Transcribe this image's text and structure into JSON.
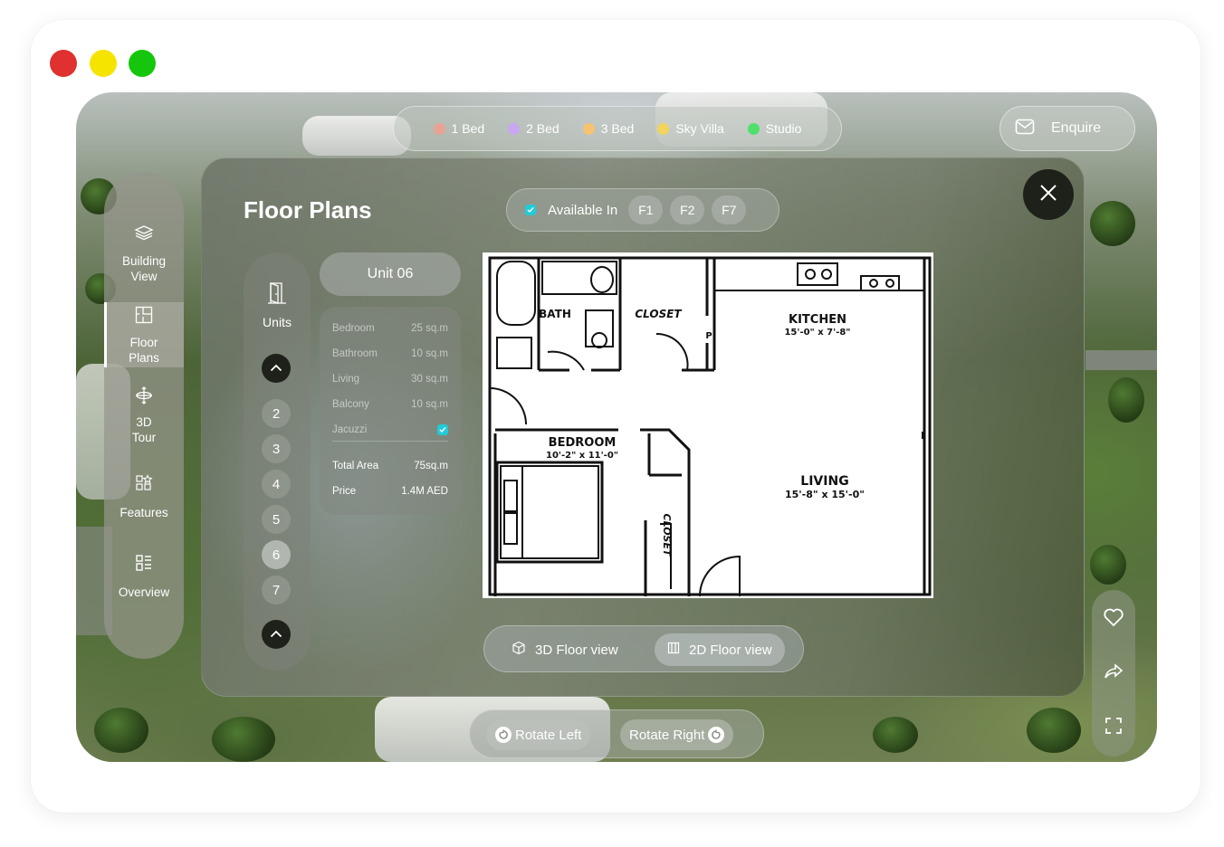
{
  "legend": [
    {
      "label": "1 Bed",
      "color": "#e8a394"
    },
    {
      "label": "2 Bed",
      "color": "#c9a7f0"
    },
    {
      "label": "3 Bed",
      "color": "#f5c372"
    },
    {
      "label": "Sky Villa",
      "color": "#f2d45c"
    },
    {
      "label": "Studio",
      "color": "#4fe06c"
    }
  ],
  "enquire_label": "Enquire",
  "sidebar": {
    "items": [
      {
        "label": "Building\nView",
        "icon": "layers-icon"
      },
      {
        "label": "Floor\nPlans",
        "icon": "floor-plan-icon"
      },
      {
        "label": "3D\nTour",
        "icon": "tour-3d-icon"
      },
      {
        "label": "Features",
        "icon": "features-icon"
      },
      {
        "label": "Overview",
        "icon": "overview-icon"
      }
    ]
  },
  "panel": {
    "title": "Floor Plans",
    "available_label": "Available In",
    "floors": [
      "F1",
      "F2",
      "F7"
    ]
  },
  "units": {
    "label": "Units",
    "numbers": [
      "2",
      "3",
      "4",
      "5",
      "6",
      "7"
    ],
    "selected": "6"
  },
  "unit": {
    "name": "Unit 06",
    "rooms": [
      {
        "name": "Bedroom",
        "value": "25 sq.m"
      },
      {
        "name": "Bathroom",
        "value": "10 sq.m"
      },
      {
        "name": "Living",
        "value": "30 sq.m"
      },
      {
        "name": "Balcony",
        "value": "10 sq.m"
      },
      {
        "name": "Jacuzzi",
        "value": ""
      }
    ],
    "total_label": "Total Area",
    "total_value": "75sq.m",
    "price_label": "Price",
    "price_value": "1.4M AED"
  },
  "plan": {
    "bath": "BATH",
    "closet_top": "CLOSET",
    "kitchen": "KITCHEN",
    "kitchen_dim": "15'-0\" x 7'-8\"",
    "pantry": "P",
    "bedroom": "BEDROOM",
    "bedroom_dim": "10'-2\" x 11'-0\"",
    "closet_side": "CLOSET",
    "living": "LIVING",
    "living_dim": "15'-8\" x 15'-0\""
  },
  "view_toggle": {
    "view_3d": "3D Floor view",
    "view_2d": "2D Floor view"
  },
  "rotate": {
    "left": "Rotate Left",
    "right": "Rotate Right"
  },
  "colors": {
    "accent": "#22cbd8",
    "dark": "#1e2119"
  }
}
